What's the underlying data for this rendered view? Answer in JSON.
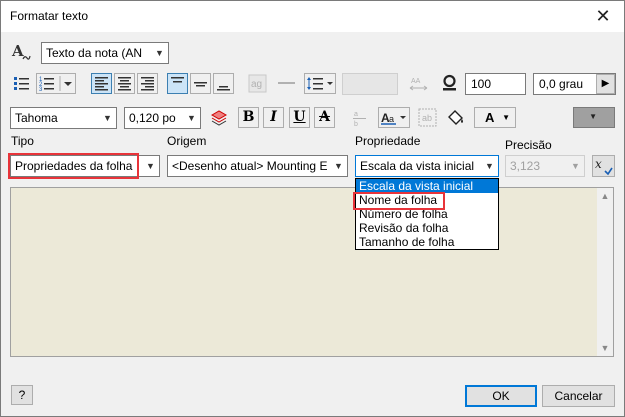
{
  "window": {
    "title": "Formatar texto"
  },
  "style_combo": {
    "value": "Texto da nota (AN"
  },
  "row1": {
    "spacing_value": "100",
    "rotation_value": "0,0 grau"
  },
  "row2": {
    "font": "Tahoma",
    "size": "0,120 po",
    "bold": "B",
    "italic": "I",
    "underline": "U",
    "strike": "A",
    "color_letter": "A"
  },
  "labels": {
    "tipo": "Tipo",
    "origem": "Origem",
    "propriedade": "Propriedade",
    "precisao": "Precisão"
  },
  "tipo_combo": {
    "value": "Propriedades da folha"
  },
  "origem_combo": {
    "value": "<Desenho atual> Mounting E"
  },
  "propriedade_combo": {
    "value": "Escala da vista inicial"
  },
  "precisao_combo": {
    "value": "3,123"
  },
  "propriedade_options": [
    "Escala da vista inicial",
    "Nome da folha",
    "Número de folha",
    "Revisão da folha",
    "Tamanho de folha"
  ],
  "footer": {
    "help": "?",
    "ok": "OK",
    "cancel": "Cancelar"
  },
  "colors": {
    "highlight": "#e8343a",
    "selection": "#0078d7",
    "editor_bg": "#ece9d8"
  }
}
